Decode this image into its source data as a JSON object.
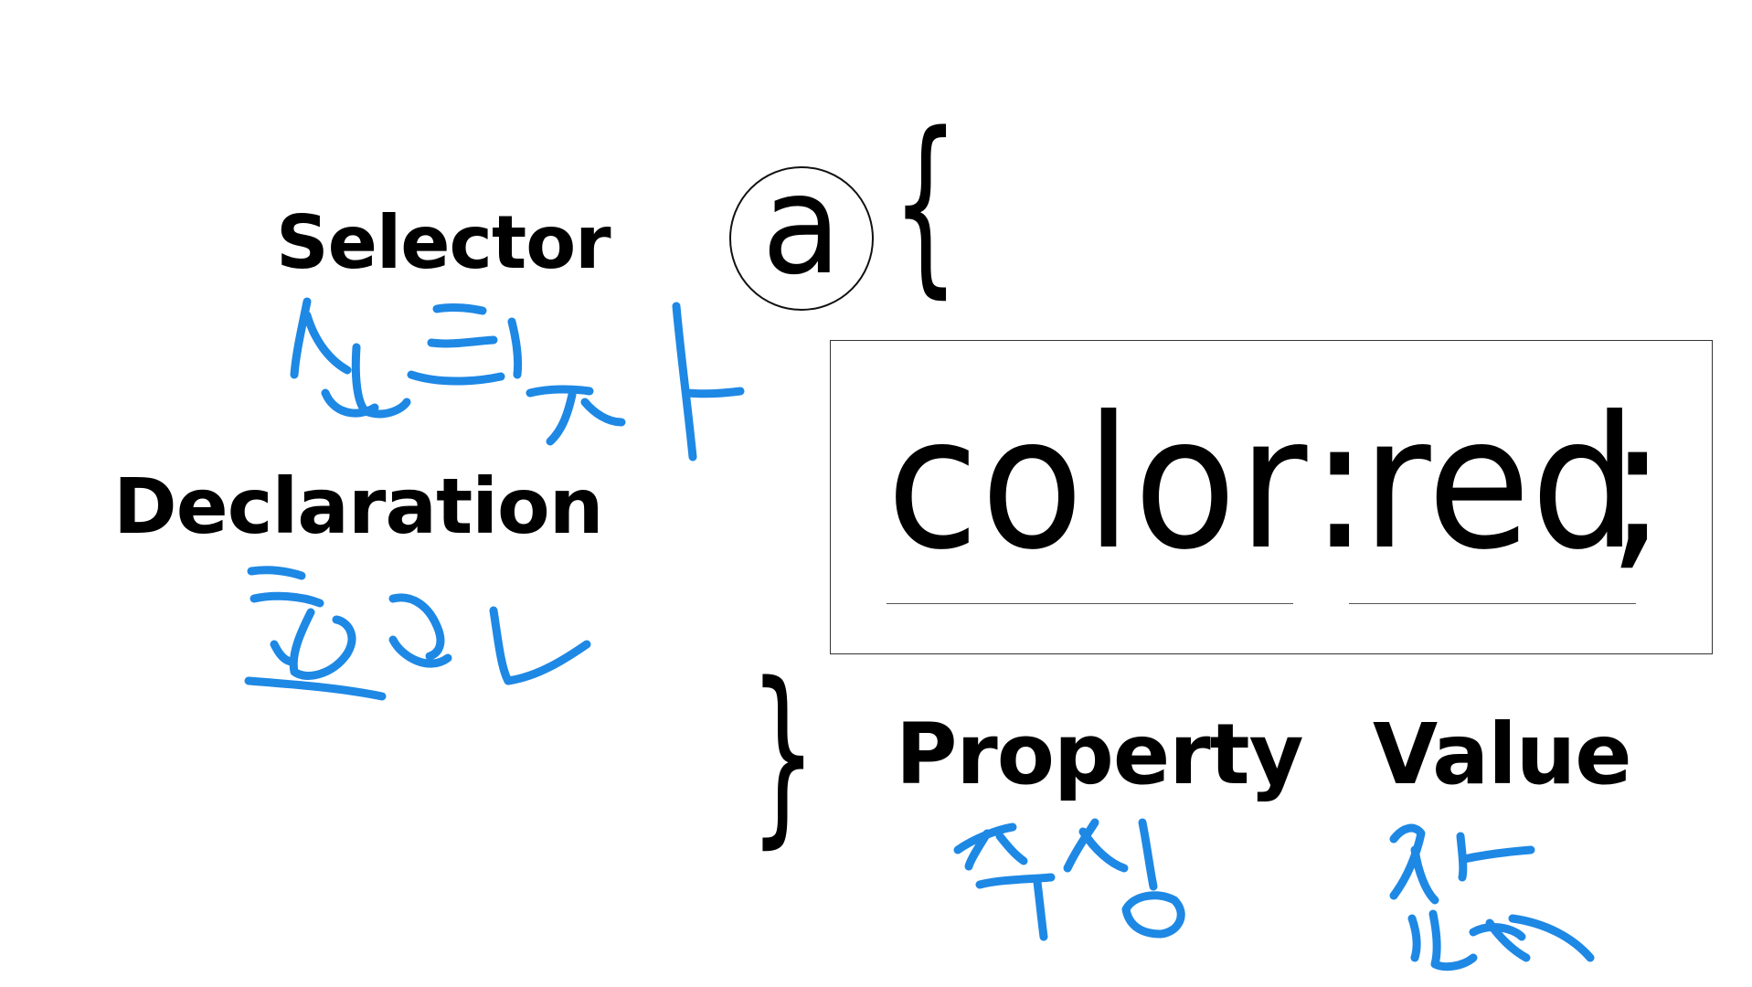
{
  "labels": {
    "selector": "Selector",
    "declaration": "Declaration",
    "property": "Property",
    "value": "Value"
  },
  "rule": {
    "selector": "a",
    "open_brace": "{",
    "property": "color",
    "colon": ":",
    "value": "red",
    "semicolon": ";",
    "close_brace": "}"
  },
  "annotations": {
    "selector_korean": "선택자",
    "declaration_korean": "선언",
    "property_korean": "속성",
    "value_korean": "값",
    "ink_color": "#1e88e5"
  }
}
